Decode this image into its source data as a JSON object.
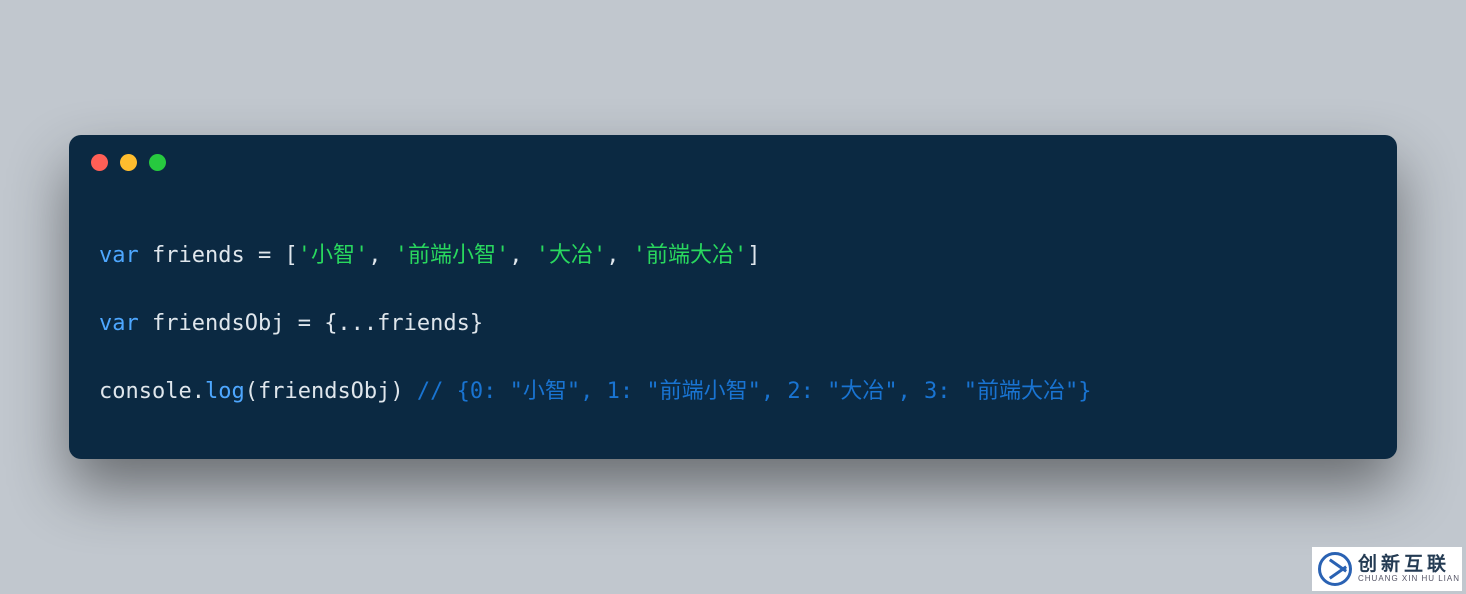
{
  "code": {
    "line1": {
      "kw": "var",
      "name": "friends",
      "eq": " = [",
      "s1": "'小智'",
      "c1": ", ",
      "s2": "'前端小智'",
      "c2": ", ",
      "s3": "'大冶'",
      "c3": ", ",
      "s4": "'前端大冶'",
      "close": "]"
    },
    "line2": {
      "kw": "var",
      "name": "friendsObj",
      "eq": " = {...",
      "ref": "friends",
      "close": "}"
    },
    "line3": {
      "obj": "console",
      "dot": ".",
      "fn": "log",
      "open": "(",
      "arg": "friendsObj",
      "close": ") ",
      "comment": "// {0: \"小智\", 1: \"前端小智\", 2: \"大冶\", 3: \"前端大冶\"}"
    }
  },
  "watermark": {
    "cn": "创新互联",
    "en": "CHUANG XIN HU LIAN"
  }
}
